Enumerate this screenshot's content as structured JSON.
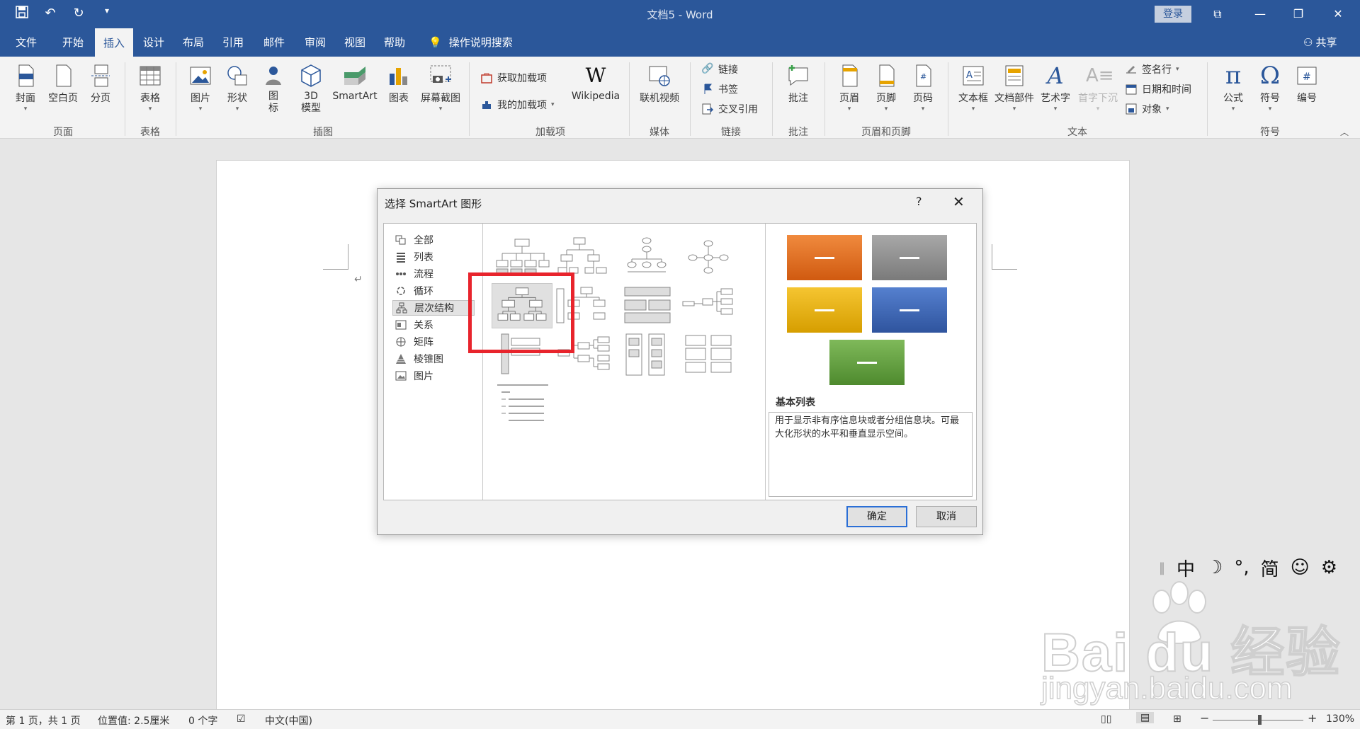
{
  "window": {
    "title": "文档5 - Word",
    "login_label": "登录",
    "qat": {
      "save_icon": "save-icon",
      "undo_icon": "undo-icon",
      "redo_icon": "redo-icon",
      "customize_icon": "customize-qat-icon"
    }
  },
  "tabs": {
    "items": [
      "文件",
      "开始",
      "插入",
      "设计",
      "布局",
      "引用",
      "邮件",
      "审阅",
      "视图",
      "帮助"
    ],
    "active": "插入",
    "tell_me": "操作说明搜索",
    "share": "共享"
  },
  "ribbon": {
    "groups": {
      "pages": {
        "label": "页面",
        "buttons": [
          "封面",
          "空白页",
          "分页"
        ]
      },
      "tables": {
        "label": "表格",
        "buttons": [
          "表格"
        ]
      },
      "illustrations": {
        "label": "插图",
        "buttons": [
          "图片",
          "形状",
          "图\n标",
          "3D\n模型",
          "SmartArt",
          "图表",
          "屏幕截图"
        ]
      },
      "addins": {
        "label": "加载项",
        "get": "获取加载项",
        "mine": "我的加载项",
        "wikipedia": "Wikipedia"
      },
      "media": {
        "label": "媒体",
        "buttons": [
          "联机视频"
        ]
      },
      "links": {
        "label": "链接",
        "items": [
          "链接",
          "书签",
          "交叉引用"
        ]
      },
      "comments": {
        "label": "批注",
        "buttons": [
          "批注"
        ]
      },
      "header_footer": {
        "label": "页眉和页脚",
        "buttons": [
          "页眉",
          "页脚",
          "页码"
        ]
      },
      "text": {
        "label": "文本",
        "buttons": [
          "文本框",
          "文档部件",
          "艺术字",
          "首字下沉"
        ],
        "small": [
          "签名行",
          "日期和时间",
          "对象"
        ]
      },
      "symbols": {
        "label": "符号",
        "buttons": [
          "公式",
          "符号",
          "编号"
        ]
      }
    }
  },
  "dialog": {
    "title": "选择 SmartArt 图形",
    "help": "?",
    "close": "✕",
    "categories": [
      {
        "label": "全部",
        "icon": "all-icon"
      },
      {
        "label": "列表",
        "icon": "list-icon"
      },
      {
        "label": "流程",
        "icon": "process-icon"
      },
      {
        "label": "循环",
        "icon": "cycle-icon"
      },
      {
        "label": "层次结构",
        "icon": "hierarchy-icon"
      },
      {
        "label": "关系",
        "icon": "relationship-icon"
      },
      {
        "label": "矩阵",
        "icon": "matrix-icon"
      },
      {
        "label": "棱锥图",
        "icon": "pyramid-icon"
      },
      {
        "label": "图片",
        "icon": "picture-icon"
      }
    ],
    "selected_category": "层次结构",
    "preview": {
      "name": "基本列表",
      "description": "用于显示非有序信息块或者分组信息块。可最大化形状的水平和垂直显示空间。",
      "colors": [
        "#e06a22",
        "#8c8c8c",
        "#e8b100",
        "#3b62b0",
        "#5e9a3c"
      ]
    },
    "ok": "确定",
    "cancel": "取消"
  },
  "ime": {
    "items": [
      "中",
      "☽",
      "°,",
      "简",
      "☺",
      "⚙"
    ]
  },
  "watermark": {
    "brand": "Bai du 经验",
    "url": "jingyan.baidu.com"
  },
  "status": {
    "page": "第 1 页，共 1 页",
    "position": "位置值: 2.5厘米",
    "words": "0 个字",
    "language": "中文(中国)",
    "zoom": "130%"
  }
}
